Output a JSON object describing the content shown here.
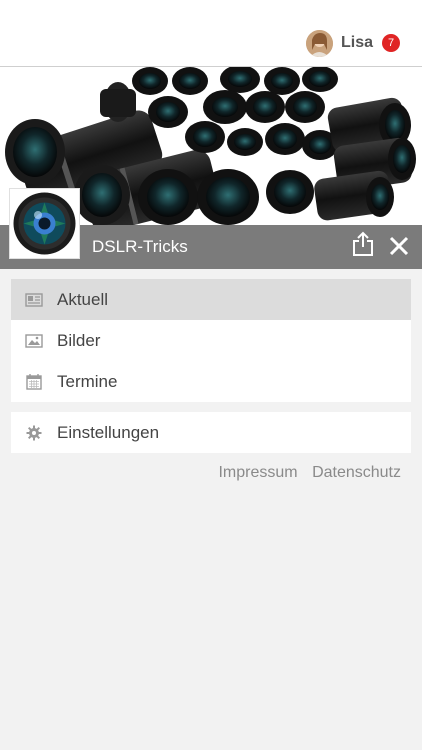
{
  "user": {
    "name": "Lisa",
    "notifications": "7"
  },
  "channel": {
    "title": "DSLR-Tricks"
  },
  "menu": {
    "items": [
      {
        "label": "Aktuell",
        "icon": "news-icon"
      },
      {
        "label": "Bilder",
        "icon": "image-icon"
      },
      {
        "label": "Termine",
        "icon": "calendar-icon"
      }
    ],
    "settings": {
      "label": "Einstellungen",
      "icon": "gear-icon"
    }
  },
  "footer": {
    "imprint": "Impressum",
    "privacy": "Datenschutz"
  },
  "colors": {
    "badge": "#e02424",
    "band": "#7b7b7b",
    "active_item": "#dcdcdc"
  }
}
